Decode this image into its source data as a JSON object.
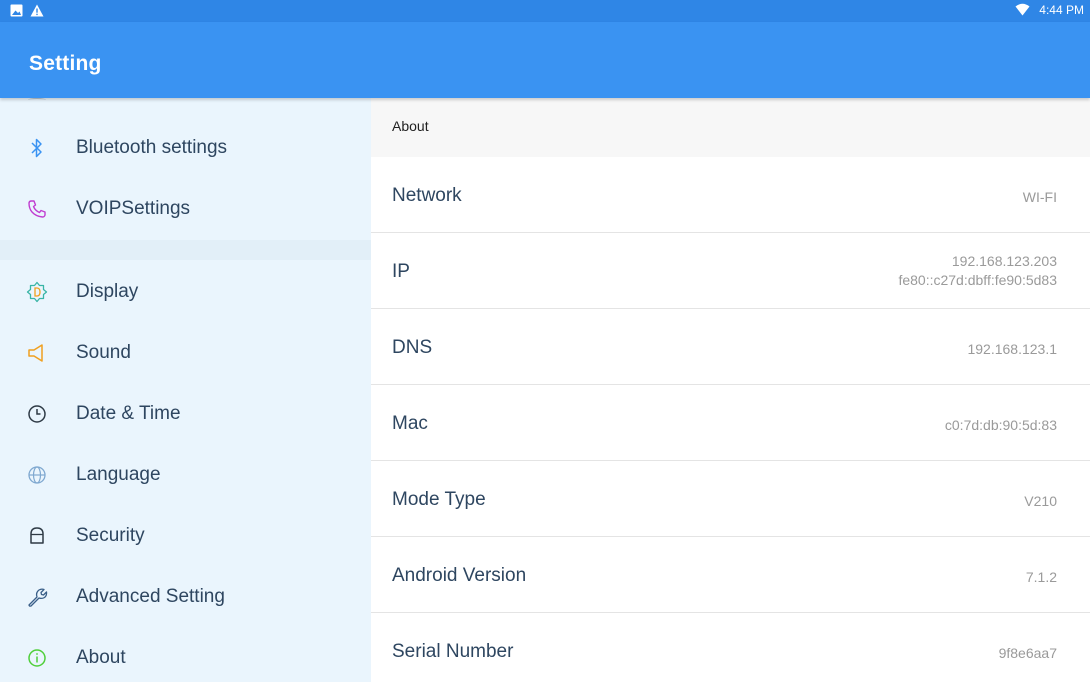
{
  "status_bar": {
    "time": "4:44 PM",
    "left_icons": [
      "image-icon",
      "warning-icon"
    ],
    "right_icons": [
      "wifi-icon"
    ]
  },
  "app_bar": {
    "title": "Setting"
  },
  "sidebar": {
    "items": [
      {
        "label": "Bluetooth settings",
        "icon": "bluetooth-icon",
        "color": "#3a93f2"
      },
      {
        "label": "VOIPSettings",
        "icon": "phone-icon",
        "color": "#c03dd0"
      },
      {
        "label": "Display",
        "icon": "display-icon",
        "color": "#39b5a6"
      },
      {
        "label": "Sound",
        "icon": "speaker-icon",
        "color": "#f0a020"
      },
      {
        "label": "Date & Time",
        "icon": "clock-icon",
        "color": "#2e3a45"
      },
      {
        "label": "Language",
        "icon": "globe-icon",
        "color": "#7fa8d0"
      },
      {
        "label": "Security",
        "icon": "lock-icon",
        "color": "#2e3a45"
      },
      {
        "label": "Advanced Setting",
        "icon": "wrench-icon",
        "color": "#3a5f88"
      },
      {
        "label": "About",
        "icon": "info-icon",
        "color": "#4fcf3a"
      }
    ]
  },
  "about": {
    "header": "About",
    "rows": [
      {
        "key": "Network",
        "value": "WI-FI"
      },
      {
        "key": "IP",
        "value": "192.168.123.203",
        "value2": "fe80::c27d:dbff:fe90:5d83"
      },
      {
        "key": "DNS",
        "value": "192.168.123.1"
      },
      {
        "key": "Mac",
        "value": "c0:7d:db:90:5d:83"
      },
      {
        "key": "Mode Type",
        "value": "V210"
      },
      {
        "key": "Android Version",
        "value": "7.1.2"
      },
      {
        "key": "Serial Number",
        "value": "9f8e6aa7"
      }
    ]
  },
  "colors": {
    "status_bar": "#2f86e6",
    "app_bar": "#3a93f2",
    "sidebar_bg": "#eaf5fd"
  }
}
